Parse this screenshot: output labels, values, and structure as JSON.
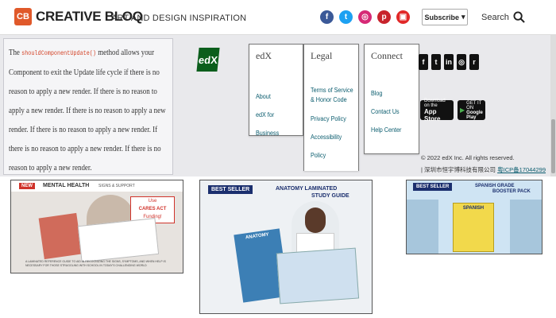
{
  "header": {
    "logo_badge": "CB",
    "logo_text": "CREATIVE BLOQ",
    "tagline": "ART AND DESIGN INSPIRATION",
    "social": [
      {
        "name": "facebook-icon",
        "glyph": "f",
        "color": "#3b5998"
      },
      {
        "name": "twitter-icon",
        "glyph": "t",
        "color": "#1da1f2"
      },
      {
        "name": "instagram-icon",
        "glyph": "◎",
        "color": "#d62976"
      },
      {
        "name": "pinterest-icon",
        "glyph": "p",
        "color": "#c8232c"
      },
      {
        "name": "flipboard-icon",
        "glyph": "▣",
        "color": "#e12828"
      }
    ],
    "subscribe_label": "Subscribe",
    "search_label": "Search"
  },
  "text_panel": {
    "lead": "The ",
    "code": "shouldComponentUpdate()",
    "body": " method allows your Component to exit the Update life cycle if there is no reason to apply a new render. If there is no reason to apply a new render. If there is no reason to apply a new render. If there is no reason to apply a new render. If there is no reason to apply a new render. If there is no reason to apply a new render."
  },
  "footer": {
    "logo": "edX",
    "columns": [
      {
        "heading": "edX",
        "links": [
          "About",
          "edX for Business"
        ]
      },
      {
        "heading": "Legal",
        "links": [
          "Terms of Service & Honor Code",
          "Privacy Policy",
          "Accessibility Policy"
        ]
      },
      {
        "heading": "Connect",
        "links": [
          "Blog",
          "Contact Us",
          "Help Center"
        ]
      }
    ],
    "app_social": [
      "f",
      "t",
      "in",
      "◎",
      "r"
    ],
    "app_store": {
      "small": "Download on the",
      "big": "App Store"
    },
    "google_play": {
      "small": "GET IT ON",
      "big": "Google Play"
    },
    "copyright": "© 2022 edX Inc. All rights reserved.",
    "icp_text": "| 深圳市恒宇博科技有限公司 ",
    "icp_link": "粤ICP备17044299"
  },
  "ads": [
    {
      "tag": "NEW",
      "title": "MENTAL HEALTH",
      "subtitle": "SIGNS & SUPPORT",
      "callout_1": "Use",
      "callout_2": "CARES ACT",
      "callout_3": "Funding!",
      "footnote": "A LAMINATED REFERENCE GUIDE TO AID IN RECOGNIZING THE SIGNS, SYMPTOMS, AND WHEN HELP IS NECESSARY FOR THOSE STRUGGLING WITH SCHOOL IN TODAY'S CHALLENGING WORLD"
    },
    {
      "tag": "BEST SELLER",
      "title": "ANATOMY LAMINATED",
      "title_2": "STUDY GUIDE",
      "book_label": "ANATOMY"
    },
    {
      "tag": "BEST SELLER",
      "title": "SPANISH GRADE",
      "title_2": "BOOSTER PACK",
      "book_label": "SPANISH"
    }
  ]
}
